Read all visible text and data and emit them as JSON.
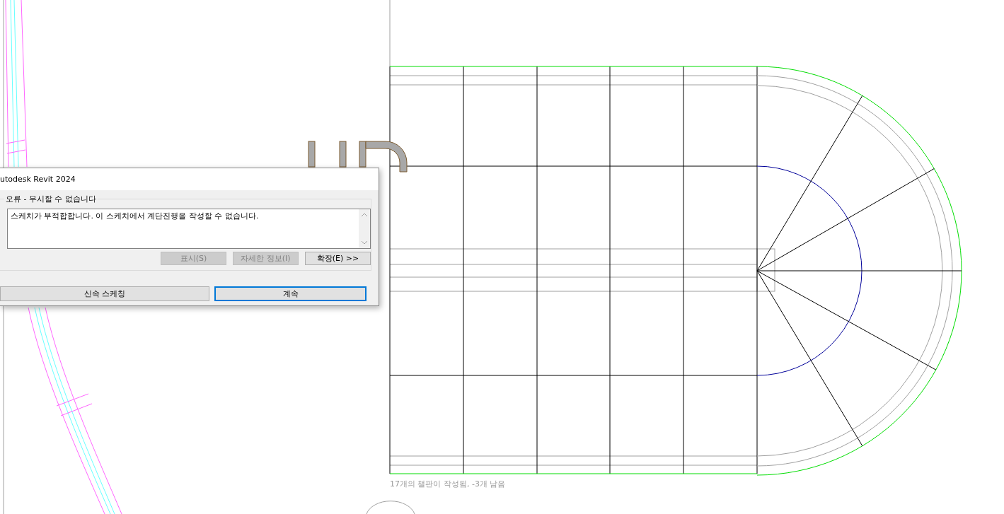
{
  "canvas": {
    "status_text": "17개의 챌판이 작성됨, -3개 남음"
  },
  "dialog": {
    "title": "utodesk Revit 2024",
    "group_label": "오류 - 무시할 수 없습니다",
    "message": "스케치가 부적합합니다. 이 스케치에서 계단진행을 작성할 수 없습니다.",
    "detail_buttons": [
      {
        "label": "표시(S)",
        "disabled": true
      },
      {
        "label": "자세한 정보(I)",
        "disabled": true
      },
      {
        "label": "확장(E) >>",
        "disabled": false
      }
    ],
    "buttons": [
      {
        "label": "신속 스케칭",
        "default": false
      },
      {
        "label": "계속",
        "default": true
      }
    ]
  }
}
